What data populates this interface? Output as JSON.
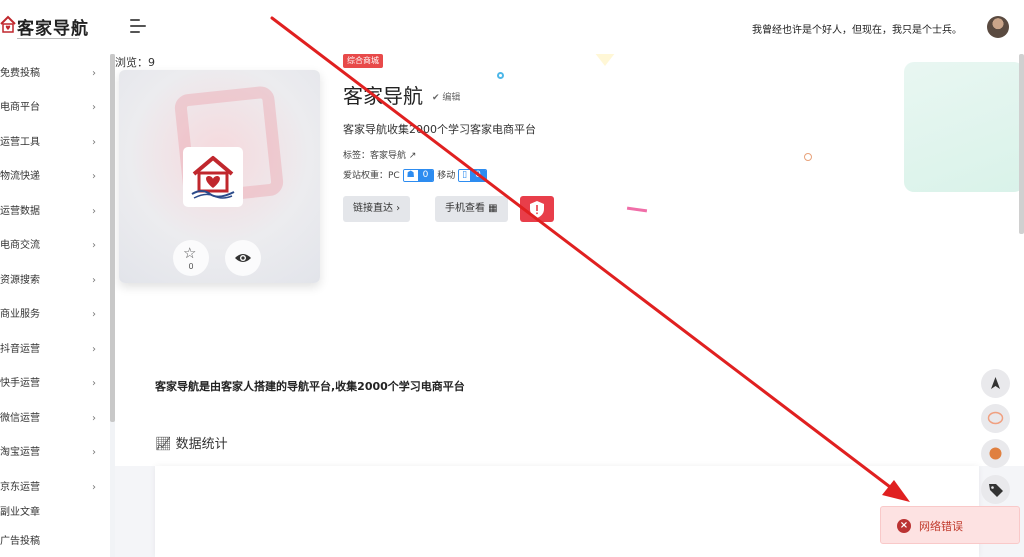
{
  "header": {
    "logo_text": "客家导航",
    "motto": "我曾经也许是个好人，但现在，我只是个士兵。"
  },
  "sidebar": {
    "items": [
      {
        "label": "免费投稿"
      },
      {
        "label": "电商平台"
      },
      {
        "label": "运营工具"
      },
      {
        "label": "物流快递"
      },
      {
        "label": "运营数据"
      },
      {
        "label": "电商交流"
      },
      {
        "label": "资源搜索"
      },
      {
        "label": "商业服务"
      },
      {
        "label": "抖音运营"
      },
      {
        "label": "快手运营"
      },
      {
        "label": "微信运营"
      },
      {
        "label": "淘宝运营"
      },
      {
        "label": "京东运营"
      },
      {
        "label": "副业文章"
      },
      {
        "label": "广告投稿"
      }
    ]
  },
  "site": {
    "views_label": "浏览：9",
    "category_tag": "综合商城",
    "title": "客家导航",
    "edit_label": "编辑",
    "description": "客家导航收集2000个学习客家电商平台",
    "tags_label": "标签：客家导航",
    "weight_label": "爱站权重：PC",
    "pc_weight": "0",
    "mobile_label": "移动",
    "mobile_weight": "0",
    "fav_count": "0",
    "visit_button": "链接直达",
    "mobile_view_button": "手机查看"
  },
  "content": {
    "intro": "客家导航是由客家人搭建的导航平台,收集2000个学习电商平台",
    "stats_heading": "数据统计"
  },
  "toast": {
    "message": "网络错误"
  },
  "colors": {
    "accent_red": "#e84a4a",
    "badge_blue": "#2d8cf0",
    "annotation_arrow": "#e02020"
  }
}
